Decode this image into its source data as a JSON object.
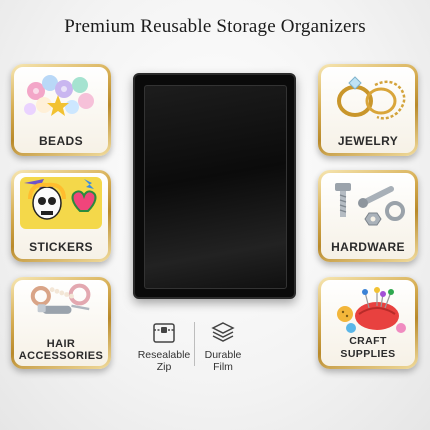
{
  "title": "Premium Reusable Storage Organizers",
  "categories": {
    "beads": "BEADS",
    "stickers": "STICKERS",
    "hair_accessories": "HAIR\nACCESSORIES",
    "jewelry": "JEWELRY",
    "hardware": "HARDWARE",
    "craft_supplies": "CRAFT SUPPLIES"
  },
  "features": {
    "resealable": "Resealable\nZip",
    "durable": "Durable\nFilm"
  }
}
